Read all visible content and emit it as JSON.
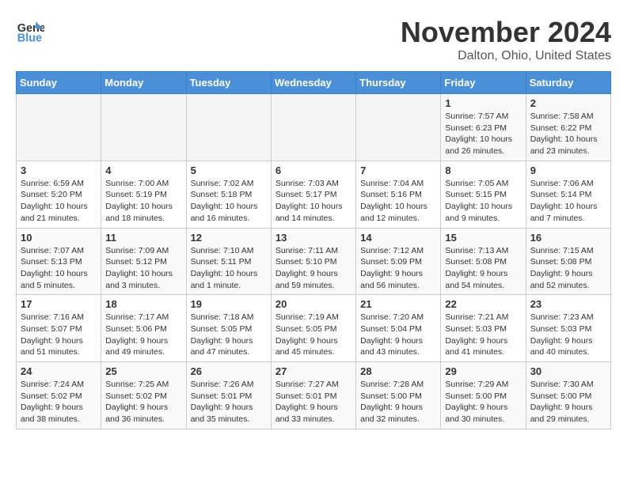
{
  "header": {
    "logo_line1": "General",
    "logo_line2": "Blue",
    "month": "November 2024",
    "location": "Dalton, Ohio, United States"
  },
  "weekdays": [
    "Sunday",
    "Monday",
    "Tuesday",
    "Wednesday",
    "Thursday",
    "Friday",
    "Saturday"
  ],
  "weeks": [
    [
      {
        "day": "",
        "info": ""
      },
      {
        "day": "",
        "info": ""
      },
      {
        "day": "",
        "info": ""
      },
      {
        "day": "",
        "info": ""
      },
      {
        "day": "",
        "info": ""
      },
      {
        "day": "1",
        "info": "Sunrise: 7:57 AM\nSunset: 6:23 PM\nDaylight: 10 hours\nand 26 minutes."
      },
      {
        "day": "2",
        "info": "Sunrise: 7:58 AM\nSunset: 6:22 PM\nDaylight: 10 hours\nand 23 minutes."
      }
    ],
    [
      {
        "day": "3",
        "info": "Sunrise: 6:59 AM\nSunset: 5:20 PM\nDaylight: 10 hours\nand 21 minutes."
      },
      {
        "day": "4",
        "info": "Sunrise: 7:00 AM\nSunset: 5:19 PM\nDaylight: 10 hours\nand 18 minutes."
      },
      {
        "day": "5",
        "info": "Sunrise: 7:02 AM\nSunset: 5:18 PM\nDaylight: 10 hours\nand 16 minutes."
      },
      {
        "day": "6",
        "info": "Sunrise: 7:03 AM\nSunset: 5:17 PM\nDaylight: 10 hours\nand 14 minutes."
      },
      {
        "day": "7",
        "info": "Sunrise: 7:04 AM\nSunset: 5:16 PM\nDaylight: 10 hours\nand 12 minutes."
      },
      {
        "day": "8",
        "info": "Sunrise: 7:05 AM\nSunset: 5:15 PM\nDaylight: 10 hours\nand 9 minutes."
      },
      {
        "day": "9",
        "info": "Sunrise: 7:06 AM\nSunset: 5:14 PM\nDaylight: 10 hours\nand 7 minutes."
      }
    ],
    [
      {
        "day": "10",
        "info": "Sunrise: 7:07 AM\nSunset: 5:13 PM\nDaylight: 10 hours\nand 5 minutes."
      },
      {
        "day": "11",
        "info": "Sunrise: 7:09 AM\nSunset: 5:12 PM\nDaylight: 10 hours\nand 3 minutes."
      },
      {
        "day": "12",
        "info": "Sunrise: 7:10 AM\nSunset: 5:11 PM\nDaylight: 10 hours\nand 1 minute."
      },
      {
        "day": "13",
        "info": "Sunrise: 7:11 AM\nSunset: 5:10 PM\nDaylight: 9 hours\nand 59 minutes."
      },
      {
        "day": "14",
        "info": "Sunrise: 7:12 AM\nSunset: 5:09 PM\nDaylight: 9 hours\nand 56 minutes."
      },
      {
        "day": "15",
        "info": "Sunrise: 7:13 AM\nSunset: 5:08 PM\nDaylight: 9 hours\nand 54 minutes."
      },
      {
        "day": "16",
        "info": "Sunrise: 7:15 AM\nSunset: 5:08 PM\nDaylight: 9 hours\nand 52 minutes."
      }
    ],
    [
      {
        "day": "17",
        "info": "Sunrise: 7:16 AM\nSunset: 5:07 PM\nDaylight: 9 hours\nand 51 minutes."
      },
      {
        "day": "18",
        "info": "Sunrise: 7:17 AM\nSunset: 5:06 PM\nDaylight: 9 hours\nand 49 minutes."
      },
      {
        "day": "19",
        "info": "Sunrise: 7:18 AM\nSunset: 5:05 PM\nDaylight: 9 hours\nand 47 minutes."
      },
      {
        "day": "20",
        "info": "Sunrise: 7:19 AM\nSunset: 5:05 PM\nDaylight: 9 hours\nand 45 minutes."
      },
      {
        "day": "21",
        "info": "Sunrise: 7:20 AM\nSunset: 5:04 PM\nDaylight: 9 hours\nand 43 minutes."
      },
      {
        "day": "22",
        "info": "Sunrise: 7:21 AM\nSunset: 5:03 PM\nDaylight: 9 hours\nand 41 minutes."
      },
      {
        "day": "23",
        "info": "Sunrise: 7:23 AM\nSunset: 5:03 PM\nDaylight: 9 hours\nand 40 minutes."
      }
    ],
    [
      {
        "day": "24",
        "info": "Sunrise: 7:24 AM\nSunset: 5:02 PM\nDaylight: 9 hours\nand 38 minutes."
      },
      {
        "day": "25",
        "info": "Sunrise: 7:25 AM\nSunset: 5:02 PM\nDaylight: 9 hours\nand 36 minutes."
      },
      {
        "day": "26",
        "info": "Sunrise: 7:26 AM\nSunset: 5:01 PM\nDaylight: 9 hours\nand 35 minutes."
      },
      {
        "day": "27",
        "info": "Sunrise: 7:27 AM\nSunset: 5:01 PM\nDaylight: 9 hours\nand 33 minutes."
      },
      {
        "day": "28",
        "info": "Sunrise: 7:28 AM\nSunset: 5:00 PM\nDaylight: 9 hours\nand 32 minutes."
      },
      {
        "day": "29",
        "info": "Sunrise: 7:29 AM\nSunset: 5:00 PM\nDaylight: 9 hours\nand 30 minutes."
      },
      {
        "day": "30",
        "info": "Sunrise: 7:30 AM\nSunset: 5:00 PM\nDaylight: 9 hours\nand 29 minutes."
      }
    ]
  ]
}
